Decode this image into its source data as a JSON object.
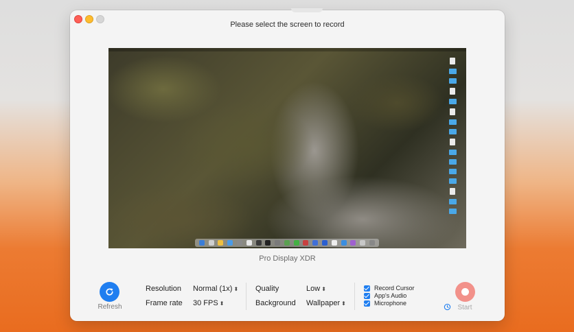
{
  "window": {
    "title": "Please select the screen to record"
  },
  "preview": {
    "display_name": "Pro Display XDR"
  },
  "controls": {
    "refresh_label": "Refresh",
    "resolution_label": "Resolution",
    "resolution_value": "Normal (1x)",
    "frame_rate_label": "Frame rate",
    "frame_rate_value": "30 FPS",
    "quality_label": "Quality",
    "quality_value": "Low",
    "background_label": "Background",
    "background_value": "Wallpaper",
    "options": [
      {
        "label": "Record Cursor",
        "checked": true
      },
      {
        "label": "App's Audio",
        "checked": true
      },
      {
        "label": "Microphone",
        "checked": true
      }
    ],
    "start_label": "Start"
  },
  "colors": {
    "accent": "#1f7ef0",
    "start": "#f2918a",
    "close": "#fe5f57",
    "minimize": "#febc2e"
  },
  "icons": [
    "refresh-icon",
    "chevron-updown-icon",
    "timer-icon",
    "record-icon"
  ]
}
